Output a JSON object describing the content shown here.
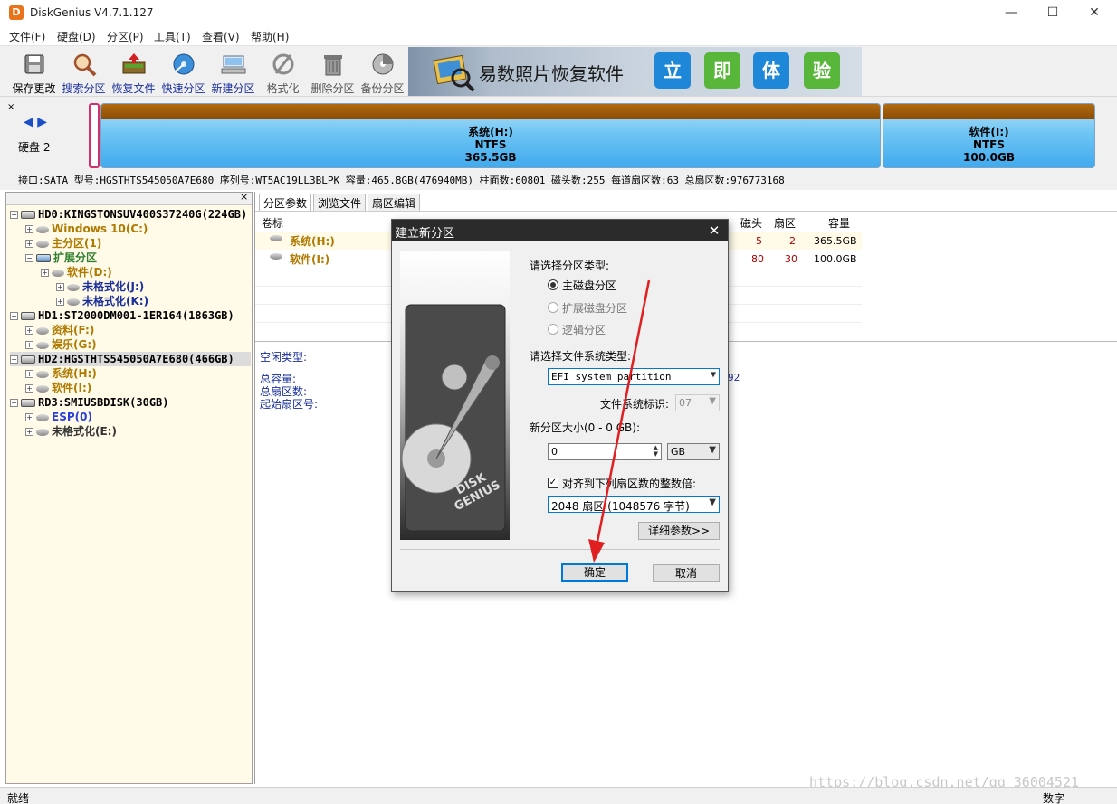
{
  "window": {
    "title": "DiskGenius V4.7.1.127",
    "logo": "D"
  },
  "window_controls": {
    "min": "—",
    "max": "☐",
    "close": "✕"
  },
  "menu": [
    "文件(F)",
    "硬盘(D)",
    "分区(P)",
    "工具(T)",
    "查看(V)",
    "帮助(H)"
  ],
  "toolbar": [
    {
      "label": "保存更改",
      "icon": "save-icon"
    },
    {
      "label": "搜索分区",
      "icon": "search-icon"
    },
    {
      "label": "恢复文件",
      "icon": "recover-icon"
    },
    {
      "label": "快速分区",
      "icon": "quick-partition-icon"
    },
    {
      "label": "新建分区",
      "icon": "new-partition-icon"
    },
    {
      "label": "格式化",
      "icon": "format-icon"
    },
    {
      "label": "删除分区",
      "icon": "trash-icon"
    },
    {
      "label": "备份分区",
      "icon": "backup-icon"
    }
  ],
  "banner": {
    "text": "易数照片恢复软件",
    "boxes": [
      "立",
      "即",
      "体",
      "验"
    ],
    "box_colors": [
      "#1f87d8",
      "#58b63b",
      "#1f87d8",
      "#58b63b"
    ]
  },
  "disk_map": {
    "nav": "◀ ▶",
    "disk_label": "硬盘 2",
    "partitions": [
      {
        "name": "系统(H:)",
        "fs": "NTFS",
        "size": "365.5GB"
      },
      {
        "name": "软件(I:)",
        "fs": "NTFS",
        "size": "100.0GB"
      }
    ],
    "info": "接口:SATA  型号:HGSTHTS545050A7E680  序列号:WT5AC19LL3BLPK  容量:465.8GB(476940MB)  柱面数:60801  磁头数:255  每道扇区数:63  总扇区数:976773168"
  },
  "tree": {
    "close": "×",
    "items": [
      {
        "text": "HD0:KINGSTONSUV400S37240G(224GB)",
        "level": 0,
        "kind": "disk",
        "color": "#000"
      },
      {
        "text": "Windows 10(C:)",
        "level": 1,
        "kind": "part",
        "color": "#b07a00"
      },
      {
        "text": "主分区(1)",
        "level": 1,
        "kind": "part",
        "color": "#b07a00"
      },
      {
        "text": "扩展分区",
        "level": 1,
        "kind": "ext",
        "color": "#2f7f2f"
      },
      {
        "text": "软件(D:)",
        "level": 2,
        "kind": "part",
        "color": "#b07a00"
      },
      {
        "text": "未格式化(J:)",
        "level": 3,
        "kind": "part",
        "color": "#1a2f9c"
      },
      {
        "text": "未格式化(K:)",
        "level": 3,
        "kind": "part",
        "color": "#1a2f9c"
      },
      {
        "text": "HD1:ST2000DM001-1ER164(1863GB)",
        "level": 0,
        "kind": "disk",
        "color": "#000"
      },
      {
        "text": "资料(F:)",
        "level": 1,
        "kind": "part",
        "color": "#b07a00"
      },
      {
        "text": "娱乐(G:)",
        "level": 1,
        "kind": "part",
        "color": "#b07a00"
      },
      {
        "text": "HD2:HGSTHTS545050A7E680(466GB)",
        "level": 0,
        "kind": "disk",
        "color": "#000",
        "selected": true
      },
      {
        "text": "系统(H:)",
        "level": 1,
        "kind": "part",
        "color": "#b07a00"
      },
      {
        "text": "软件(I:)",
        "level": 1,
        "kind": "part",
        "color": "#b07a00"
      },
      {
        "text": "RD3:SMIUSBDISK(30GB)",
        "level": 0,
        "kind": "disk",
        "color": "#000"
      },
      {
        "text": "ESP(0)",
        "level": 1,
        "kind": "part",
        "color": "#2a3fd8"
      },
      {
        "text": "未格式化(E:)",
        "level": 1,
        "kind": "part",
        "color": "#333"
      }
    ]
  },
  "right": {
    "tabs": [
      "分区参数",
      "浏览文件",
      "扇区编辑"
    ],
    "col_label": "卷标",
    "col_magnetic": "磁头",
    "col_sector": "扇区",
    "col_capacity": "容量",
    "rows": [
      {
        "label": "系统(H:)",
        "head": "5",
        "sector": "2",
        "capacity": "365.5GB"
      },
      {
        "label": "软件(I:)",
        "head": "80",
        "sector": "30",
        "capacity": "100.0GB"
      }
    ],
    "space_type": "空闲类型:",
    "total_capacity": "总容量:",
    "total_sectors": "总扇区数:",
    "start_sector": "起始扇区号:",
    "partial_number": "92"
  },
  "dialog": {
    "title": "建立新分区",
    "close": "✕",
    "select_type_label": "请选择分区类型:",
    "types": [
      "主磁盘分区",
      "扩展磁盘分区",
      "逻辑分区"
    ],
    "select_fs_label": "请选择文件系统类型:",
    "fs_value": "EFI system partition",
    "fs_id_label": "文件系统标识:",
    "fs_id_value": "07",
    "size_label": "新分区大小(0 - 0 GB):",
    "size_value": "0",
    "size_unit": "GB",
    "align_label": "对齐到下列扇区数的整数倍:",
    "align_value": "2048 扇区 (1048576 字节)",
    "detail_button": "详细参数>>",
    "ok": "确定",
    "cancel": "取消",
    "image_text": "DISK GENIUS",
    "accent": "#e02020"
  },
  "status": {
    "left": "就绪",
    "right": "数字"
  },
  "watermark": "https://blog.csdn.net/qq_36004521"
}
